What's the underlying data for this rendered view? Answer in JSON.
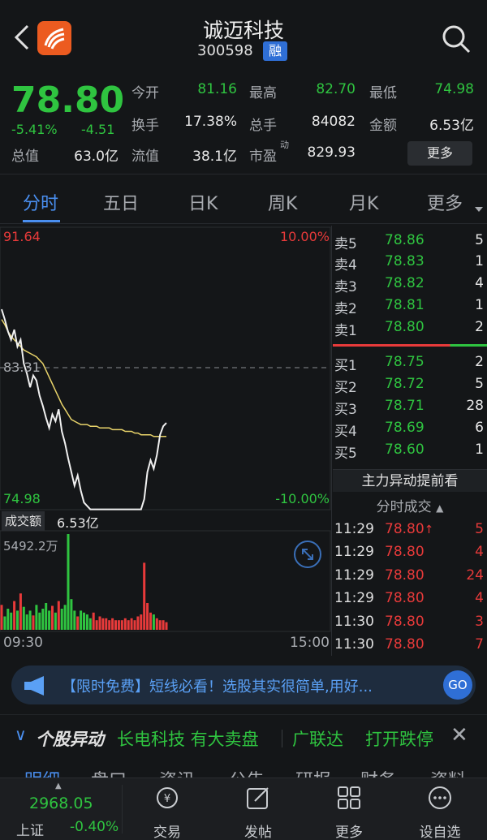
{
  "header": {
    "title": "诚迈科技",
    "code": "300598",
    "margin_badge": "融"
  },
  "quote": {
    "price": "78.80",
    "change_pct": "-5.41%",
    "change": "-4.51",
    "fields": [
      {
        "label": "今开",
        "value": "81.16",
        "color": "#2fc440"
      },
      {
        "label": "最高",
        "value": "82.70",
        "color": "#2fc440"
      },
      {
        "label": "最低",
        "value": "74.98",
        "color": "#2fc440"
      },
      {
        "label": "换手",
        "value": "17.38%",
        "color": "#e8e8e8"
      },
      {
        "label": "总手",
        "value": "84082",
        "color": "#e8e8e8"
      },
      {
        "label": "金额",
        "value": "6.53亿",
        "color": "#e8e8e8"
      },
      {
        "label": "总值",
        "value": "63.0亿",
        "color": "#e8e8e8"
      },
      {
        "label": "流值",
        "value": "38.1亿",
        "color": "#e8e8e8"
      },
      {
        "label": "市盈",
        "value": "829.93",
        "color": "#e8e8e8"
      }
    ],
    "pe_sup": "动",
    "more_label": "更多"
  },
  "tabs": [
    "分时",
    "五日",
    "日K",
    "周K",
    "月K",
    "更多"
  ],
  "chart": {
    "high_price": "91.64",
    "high_pct": "10.00%",
    "mid_price": "83.31",
    "low_price": "74.98",
    "low_pct": "-10.00%",
    "volume_label": "成交额",
    "volume_value": "6.53亿",
    "max_volume": "5492.2万",
    "time_start": "09:30",
    "time_end": "15:00"
  },
  "chart_data": {
    "type": "line",
    "series": [
      {
        "values": [
          86.8,
          86.2,
          85.5,
          85.0,
          85.6,
          84.6,
          85.0,
          83.6,
          83.0,
          82.2,
          82.9,
          82.6,
          81.7,
          81.1,
          80.4,
          79.8,
          80.6,
          80.2,
          80.9,
          79.6,
          78.9,
          78.0,
          77.2,
          76.4,
          77.0,
          76.1,
          75.4,
          75.2,
          75.0,
          75.0,
          75.0,
          75.0,
          75.0,
          75.0,
          75.0,
          75.0,
          75.0,
          75.0,
          75.0,
          75.0,
          75.0,
          75.0,
          75.0,
          75.0,
          75.0,
          75.6,
          77.2,
          77.9,
          77.4,
          78.2,
          79.4,
          79.9,
          80.1
        ]
      },
      {
        "values": [
          86.2,
          85.9,
          85.5,
          85.2,
          85.0,
          84.8,
          84.6,
          84.4,
          84.3,
          84.2,
          84.1,
          84.0,
          83.8,
          83.6,
          83.2,
          82.8,
          82.4,
          82.0,
          81.6,
          81.2,
          80.9,
          80.6,
          80.3,
          80.2,
          80.1,
          80.0,
          80.0,
          80.0,
          79.9,
          79.9,
          79.9,
          79.8,
          79.8,
          79.8,
          79.8,
          79.7,
          79.7,
          79.7,
          79.7,
          79.6,
          79.6,
          79.6,
          79.5,
          79.5,
          79.4,
          79.4,
          79.4,
          79.4,
          79.3,
          79.3,
          79.3,
          79.3,
          79.3
        ]
      }
    ],
    "volume_values": [
      26,
      14,
      22,
      18,
      30,
      20,
      38,
      24,
      16,
      20,
      15,
      26,
      18,
      22,
      28,
      20,
      25,
      18,
      30,
      22,
      26,
      100,
      32,
      20,
      14,
      20,
      18,
      16,
      12,
      18,
      10,
      14,
      12,
      12,
      10,
      12,
      10,
      10,
      10,
      12,
      10,
      12,
      10,
      14,
      16,
      70,
      28,
      18,
      16,
      12,
      10,
      10,
      8
    ],
    "ylim": [
      74.98,
      91.64
    ],
    "reference": 83.31
  },
  "order_book": {
    "asks": [
      {
        "label": "卖5",
        "price": "78.86",
        "qty": "5"
      },
      {
        "label": "卖4",
        "price": "78.83",
        "qty": "1"
      },
      {
        "label": "卖3",
        "price": "78.82",
        "qty": "4"
      },
      {
        "label": "卖2",
        "price": "78.81",
        "qty": "1"
      },
      {
        "label": "卖1",
        "price": "78.80",
        "qty": "2"
      }
    ],
    "bids": [
      {
        "label": "买1",
        "price": "78.75",
        "qty": "2"
      },
      {
        "label": "买2",
        "price": "78.72",
        "qty": "5"
      },
      {
        "label": "买3",
        "price": "78.71",
        "qty": "28"
      },
      {
        "label": "买4",
        "price": "78.69",
        "qty": "6"
      },
      {
        "label": "买5",
        "price": "78.60",
        "qty": "1"
      }
    ]
  },
  "main_force_label": "主力异动提前看",
  "ticks_title": "分时成交",
  "ticks": [
    {
      "time": "11:29",
      "price": "78.80",
      "arrow": "↑",
      "qty": "5"
    },
    {
      "time": "11:29",
      "price": "78.80",
      "arrow": "",
      "qty": "4"
    },
    {
      "time": "11:29",
      "price": "78.80",
      "arrow": "",
      "qty": "24"
    },
    {
      "time": "11:29",
      "price": "78.80",
      "arrow": "",
      "qty": "4"
    },
    {
      "time": "11:30",
      "price": "78.80",
      "arrow": "",
      "qty": "3"
    },
    {
      "time": "11:30",
      "price": "78.80",
      "arrow": "",
      "qty": "7"
    }
  ],
  "banner": {
    "text": "【限时免费】短线必看！选股其实很简单,用好...",
    "go": "GO"
  },
  "alerts": {
    "brand": "个股异动",
    "items": [
      "长电科技 有大卖盘",
      "广联达",
      "打开跌停"
    ]
  },
  "hidden_tabs": [
    "明细",
    "盘口",
    "资讯",
    "公告",
    "研报",
    "财务",
    "资料"
  ],
  "bottom": {
    "index_value": "2968.05",
    "index_name": "上证",
    "index_change": "-0.40%",
    "items": [
      "交易",
      "发帖",
      "更多",
      "设自选"
    ]
  }
}
